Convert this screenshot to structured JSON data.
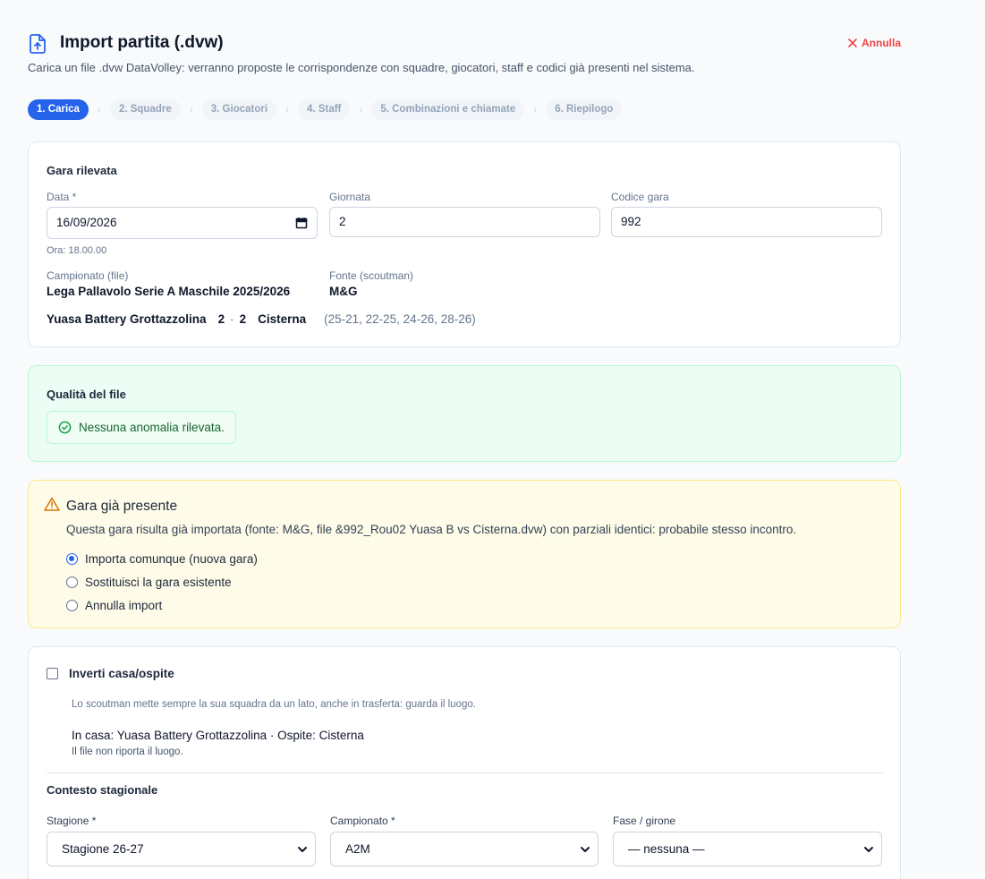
{
  "header": {
    "title": "Import partita (.dvw)",
    "cancel_label": "Annulla",
    "subtitle": "Carica un file .dvw DataVolley: verranno proposte le corrispondenze con squadre, giocatori, staff e codici già presenti nel sistema."
  },
  "steps": [
    "1. Carica",
    "2. Squadre",
    "3. Giocatori",
    "4. Staff",
    "5. Combinazioni e chiamate",
    "6. Riepilogo"
  ],
  "steps_separator": "›",
  "match": {
    "section_title": "Gara rilevata",
    "date_label": "Data *",
    "date_value": "16/09/2026",
    "time_note": "Ora: 18.00.00",
    "round_label": "Giornata",
    "round_value": "2",
    "code_label": "Codice gara",
    "code_value": "992",
    "championship_label": "Campionato (file)",
    "championship_value": "Lega Pallavolo Serie A Maschile 2025/2026",
    "source_label": "Fonte (scoutman)",
    "source_value": "M&G",
    "home_team": "Yuasa Battery Grottazzolina",
    "home_sets": "2",
    "score_sep": "-",
    "away_sets": "2",
    "away_team": "Cisterna",
    "partials": "(25-21, 22-25, 24-26, 28-26)"
  },
  "quality": {
    "title": "Qualità del file",
    "message": "Nessuna anomalia rilevata."
  },
  "duplicate": {
    "title": "Gara già presente",
    "text": "Questa gara risulta già importata (fonte: M&G, file &992_Rou02 Yuasa B vs Cisterna.dvw) con parziali identici: probabile stesso incontro.",
    "options": [
      "Importa comunque (nuova gara)",
      "Sostituisci la gara esistente",
      "Annulla import"
    ],
    "selected_index": 0
  },
  "context": {
    "swap_label": "Inverti casa/ospite",
    "swap_checked": false,
    "swap_note": "Lo scoutman mette sempre la sua squadra da un lato, anche in trasferta: guarda il luogo.",
    "home_away_line": "In casa: Yuasa Battery Grottazzolina · Ospite: Cisterna",
    "venue_note": "Il file non riporta il luogo.",
    "section_title": "Contesto stagionale",
    "season_label": "Stagione *",
    "season_value": "Stagione 26-27",
    "league_label": "Campionato *",
    "league_value": "A2M",
    "phase_label": "Fase / girone",
    "phase_value": "— nessuna —"
  },
  "colors": {
    "primary": "#2563eb",
    "danger": "#ef4444",
    "success_bg": "#ecfdf5",
    "success_text": "#166534",
    "warning_bg": "#fefce8",
    "warning_icon": "#d97706"
  }
}
